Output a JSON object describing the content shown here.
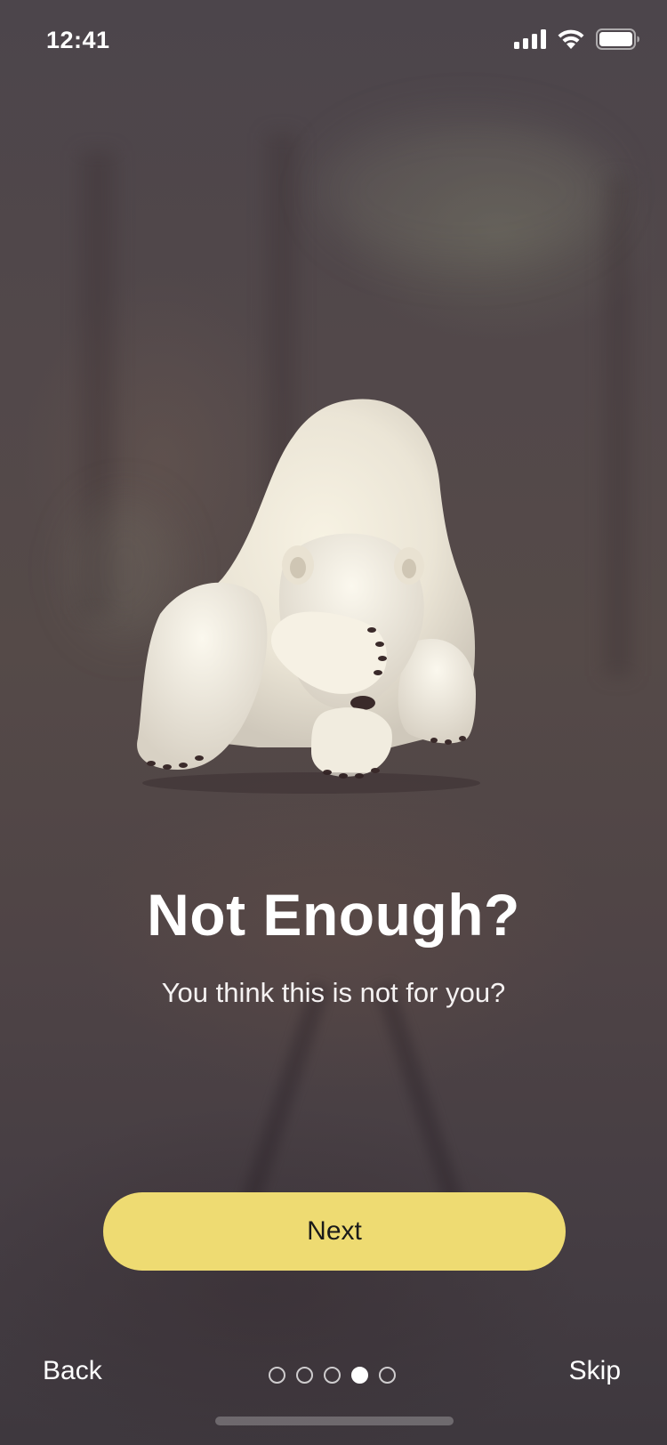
{
  "status_bar": {
    "time": "12:41",
    "icons": [
      "cellular-signal-icon",
      "wifi-icon",
      "battery-icon"
    ]
  },
  "onboarding": {
    "illustration": "polar-bear-facepalm",
    "title": "Not Enough?",
    "subtitle": "You think this is not for you?",
    "next_label": "Next",
    "back_label": "Back",
    "skip_label": "Skip",
    "pager": {
      "total_pages": 5,
      "current_page": 4
    }
  },
  "colors": {
    "accent": "#EEDB72",
    "button_text": "#1A1A1A",
    "text": "#FFFFFF",
    "background": "#4A4349"
  }
}
